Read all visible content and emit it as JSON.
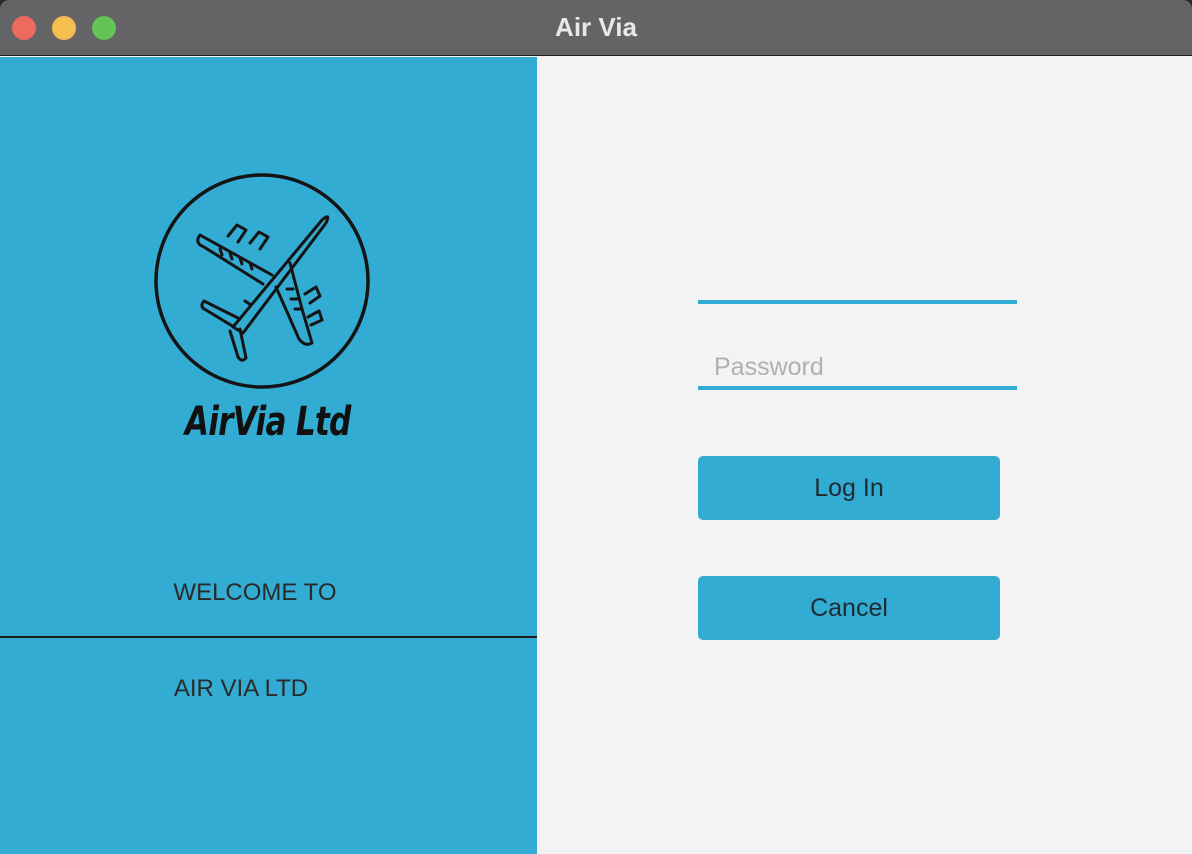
{
  "window": {
    "title": "Air Via"
  },
  "left_panel": {
    "logo_icon": "airplane-in-circle-icon",
    "welcome_line": "WELCOME TO",
    "company_line": "AIR VIA LTD"
  },
  "login_form": {
    "username": {
      "value": "",
      "placeholder": ""
    },
    "password": {
      "value": "",
      "placeholder": "Password"
    },
    "login_label": "Log In",
    "cancel_label": "Cancel"
  },
  "colors": {
    "accent": "#33acd3",
    "titlebar": "#646466",
    "form_background": "#f3f3f3",
    "close": "#ed6a5e",
    "minimize": "#f5bf4f",
    "zoom": "#61c454"
  }
}
